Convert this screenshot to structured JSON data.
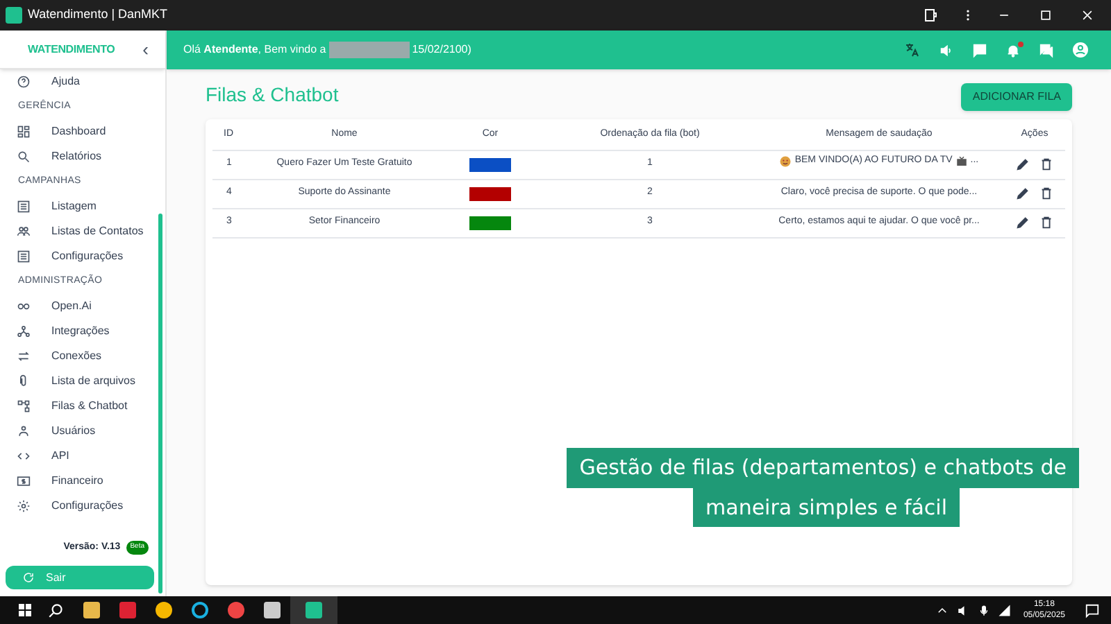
{
  "window": {
    "title": "Watendimento | DanMKT"
  },
  "sidebar": {
    "logo": "WATENDIMENTO",
    "collapse": "‹",
    "items": [
      {
        "kind": "item",
        "label": "Ajuda",
        "selected": false
      },
      {
        "kind": "section",
        "label": "GERÊNCIA"
      },
      {
        "kind": "item",
        "label": "Dashboard",
        "selected": false
      },
      {
        "kind": "item",
        "label": "Relatórios",
        "selected": false
      },
      {
        "kind": "section",
        "label": "CAMPANHAS"
      },
      {
        "kind": "item",
        "label": "Listagem",
        "selected": false
      },
      {
        "kind": "item",
        "label": "Listas de Contatos",
        "selected": false
      },
      {
        "kind": "item",
        "label": "Configurações",
        "selected": false
      },
      {
        "kind": "section",
        "label": "ADMINISTRAÇÃO"
      },
      {
        "kind": "item",
        "label": "Open.Ai",
        "selected": false
      },
      {
        "kind": "item",
        "label": "Integrações",
        "selected": false
      },
      {
        "kind": "item",
        "label": "Conexões",
        "selected": false
      },
      {
        "kind": "item",
        "label": "Lista de arquivos",
        "selected": false
      },
      {
        "kind": "item",
        "label": "Filas & Chatbot",
        "selected": false
      },
      {
        "kind": "item",
        "label": "Usuários",
        "selected": false
      },
      {
        "kind": "item",
        "label": "API",
        "selected": false
      },
      {
        "kind": "item",
        "label": "Financeiro",
        "selected": false
      },
      {
        "kind": "item",
        "label": "Configurações",
        "selected": false
      }
    ],
    "version": "Versão: V.13",
    "version_badge": "Beta",
    "logout": "Sair"
  },
  "header": {
    "greeting": "Olá **Atendente**, Bem vindo a",
    "greeting_end": "15/02/2100)",
    "notification_dot": true
  },
  "page": {
    "title": "Filas & Chatbot",
    "add_button": "ADICIONAR FILA"
  },
  "table": {
    "columns": [
      "ID",
      "Nome",
      "Cor",
      "Ordenação da fila (bot)",
      "Mensagem de saudação",
      "Ações"
    ],
    "rows": [
      {
        "id": "1",
        "name": "Quero Fazer Um Teste Gratuito",
        "color": "#0b4fc4",
        "order": "1",
        "message": "BEM VINDO(A) AO FUTURO DA TV",
        "message_end": "...",
        "emoji": true
      },
      {
        "id": "4",
        "name": "Suporte do Assinante",
        "color": "#b30000",
        "order": "2",
        "message": "Claro, você precisa de suporte. O que pode...",
        "emoji": false
      },
      {
        "id": "3",
        "name": "Setor Financeiro",
        "color": "#05870e",
        "order": "3",
        "message": "Certo, estamos aqui te ajudar. O que você pr...",
        "emoji": false
      }
    ]
  },
  "caption": [
    "Gestão de filas (departamentos) e chatbots de",
    "maneira simples e fácil"
  ],
  "taskbar": {
    "time": "15:18",
    "date": "05/05/2025"
  }
}
